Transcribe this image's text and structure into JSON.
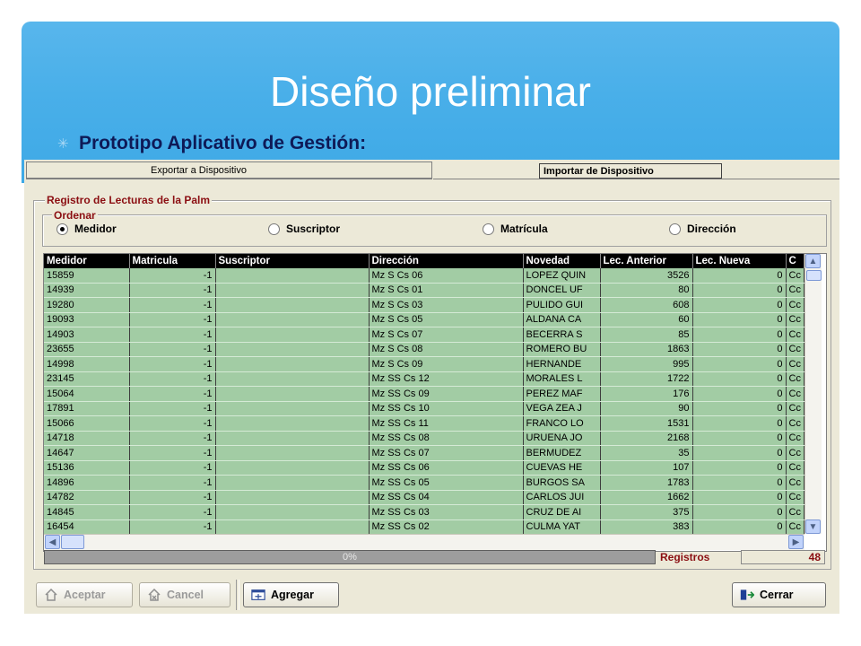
{
  "slide": {
    "title": "Diseño preliminar",
    "bullet": "Prototipo Aplicativo de Gestión:"
  },
  "tabs": {
    "export": "Exportar a Dispositivo",
    "import": "Importar de Dispositivo"
  },
  "registro": {
    "group_title": "Registro de Lecturas de la Palm",
    "order_title": "Ordenar",
    "order_options": [
      "Medidor",
      "Suscriptor",
      "Matrícula",
      "Dirección"
    ],
    "order_selected": "Medidor"
  },
  "grid": {
    "columns": [
      "Medidor",
      "Matricula",
      "Suscriptor",
      "Dirección",
      "Novedad",
      "Lec. Anterior",
      "Lec. Nueva",
      "C"
    ],
    "rows": [
      [
        "15859",
        "-1",
        "",
        "Mz S Cs 06",
        "LOPEZ QUIN",
        "3526",
        "0",
        "Cc"
      ],
      [
        "14939",
        "-1",
        "",
        "Mz S Cs 01",
        "DONCEL UF",
        "80",
        "0",
        "Cc"
      ],
      [
        "19280",
        "-1",
        "",
        "Mz S Cs 03",
        "PULIDO GUI",
        "608",
        "0",
        "Cc"
      ],
      [
        "19093",
        "-1",
        "",
        "Mz S Cs 05",
        "ALDANA CA",
        "60",
        "0",
        "Cc"
      ],
      [
        "14903",
        "-1",
        "",
        "Mz S Cs 07",
        "BECERRA S",
        "85",
        "0",
        "Cc"
      ],
      [
        "23655",
        "-1",
        "",
        "Mz S Cs 08",
        "ROMERO BU",
        "1863",
        "0",
        "Cc"
      ],
      [
        "14998",
        "-1",
        "",
        "Mz S Cs 09",
        "HERNANDE",
        "995",
        "0",
        "Cc"
      ],
      [
        "23145",
        "-1",
        "",
        "Mz SS Cs 12",
        "MORALES L",
        "1722",
        "0",
        "Cc"
      ],
      [
        "15064",
        "-1",
        "",
        "Mz SS Cs 09",
        "PEREZ MAF",
        "176",
        "0",
        "Cc"
      ],
      [
        "17891",
        "-1",
        "",
        "Mz SS Cs 10",
        "VEGA ZEA J",
        "90",
        "0",
        "Cc"
      ],
      [
        "15066",
        "-1",
        "",
        "Mz SS Cs 11",
        "FRANCO LO",
        "1531",
        "0",
        "Cc"
      ],
      [
        "14718",
        "-1",
        "",
        "Mz SS Cs 08",
        "URUENA JO",
        "2168",
        "0",
        "Cc"
      ],
      [
        "14647",
        "-1",
        "",
        "Mz SS Cs 07",
        "BERMUDEZ",
        "35",
        "0",
        "Cc"
      ],
      [
        "15136",
        "-1",
        "",
        "Mz SS Cs 06",
        "CUEVAS HE",
        "107",
        "0",
        "Cc"
      ],
      [
        "14896",
        "-1",
        "",
        "Mz SS Cs 05",
        "BURGOS SA",
        "1783",
        "0",
        "Cc"
      ],
      [
        "14782",
        "-1",
        "",
        "Mz SS Cs 04",
        "CARLOS JUI",
        "1662",
        "0",
        "Cc"
      ],
      [
        "14845",
        "-1",
        "",
        "Mz SS Cs 03",
        "CRUZ DE AI",
        "375",
        "0",
        "Cc"
      ],
      [
        "16454",
        "-1",
        "",
        "Mz SS Cs 02",
        "CULMA YAT",
        "383",
        "0",
        "Cc"
      ]
    ]
  },
  "status": {
    "progress_text": "0%",
    "progress_value": 0,
    "registros_label": "Registros",
    "registros_count": "48"
  },
  "buttons": {
    "aceptar": "Aceptar",
    "cancel": "Cancel",
    "agregar": "Agregar",
    "cerrar": "Cerrar"
  },
  "icons": {
    "bullet": "star-icon",
    "scroll_up": "arrow-up-icon",
    "scroll_down": "arrow-down-icon",
    "scroll_left": "arrow-left-icon",
    "scroll_right": "arrow-right-icon"
  },
  "colors": {
    "header_blue": "#49afe9",
    "grid_row_green": "#a2cca4",
    "label_red": "#8b0e12"
  }
}
